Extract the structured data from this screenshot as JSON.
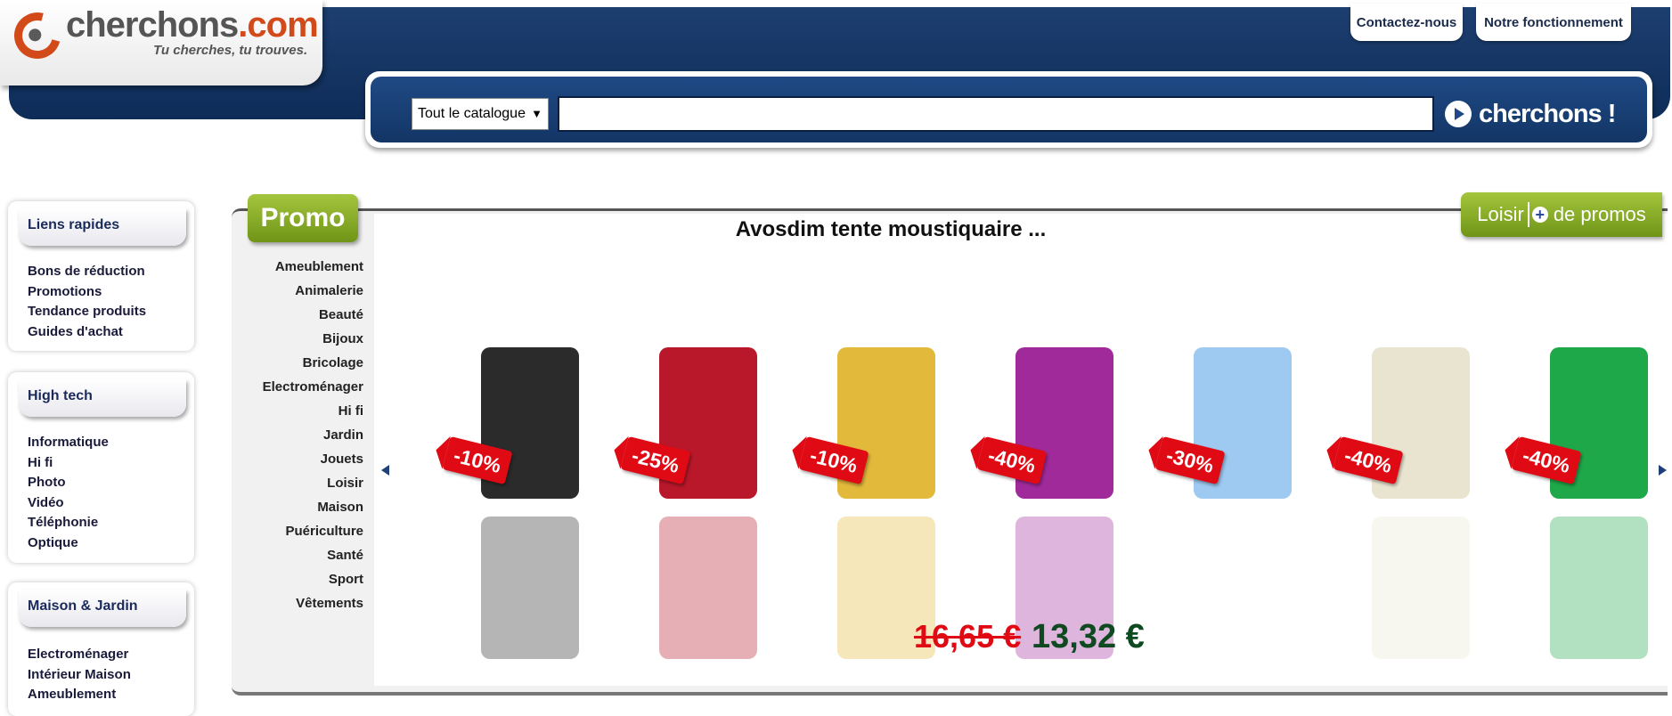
{
  "logo": {
    "name_main": "cherchons",
    "name_tld": ".com",
    "tagline": "Tu cherches, tu trouves."
  },
  "topnav": {
    "contact": "Contactez-nous",
    "how": "Notre fonctionnement"
  },
  "search": {
    "category_selected": "Tout le catalogue",
    "query": "",
    "button_label": "cherchons !"
  },
  "sidebar": [
    {
      "title": "Liens rapides",
      "items": [
        "Bons de réduction",
        "Promotions",
        "Tendance produits",
        "Guides d'achat"
      ]
    },
    {
      "title": "High tech",
      "items": [
        "Informatique",
        "Hi fi",
        "Photo",
        "Vidéo",
        "Téléphonie",
        "Optique"
      ]
    },
    {
      "title": "Maison & Jardin",
      "items": [
        "Electroménager",
        "Intérieur Maison",
        "Ameublement"
      ]
    }
  ],
  "promo": {
    "tab_label": "Promo",
    "more_category": "Loisir",
    "more_label": "de promos",
    "title": "Avosdim tente moustiquaire ...",
    "categories": [
      "Ameublement",
      "Animalerie",
      "Beauté",
      "Bijoux",
      "Bricolage",
      "Electroménager",
      "Hi fi",
      "Jardin",
      "Jouets",
      "Loisir",
      "Maison",
      "Puériculture",
      "Santé",
      "Sport",
      "Vêtements"
    ],
    "products": [
      {
        "discount": "-10%",
        "color": "#2b2b2b"
      },
      {
        "discount": "-25%",
        "color": "#b8182a"
      },
      {
        "discount": "-10%",
        "color": "#e2b93a"
      },
      {
        "discount": "-40%",
        "color": "#a02a9a"
      },
      {
        "discount": "-30%",
        "color": "#9ec9f0"
      },
      {
        "discount": "-40%",
        "color": "#e8e4d0"
      },
      {
        "discount": "-40%",
        "color": "#1fa84a"
      }
    ],
    "price_old": "16,65 €",
    "price_new": "13,32 €"
  },
  "colors": {
    "header_blue": "#133565",
    "accent_orange": "#d24a1a",
    "promo_green": "#8bb02a",
    "discount_red": "#e00a14",
    "price_green": "#0d4a20"
  }
}
